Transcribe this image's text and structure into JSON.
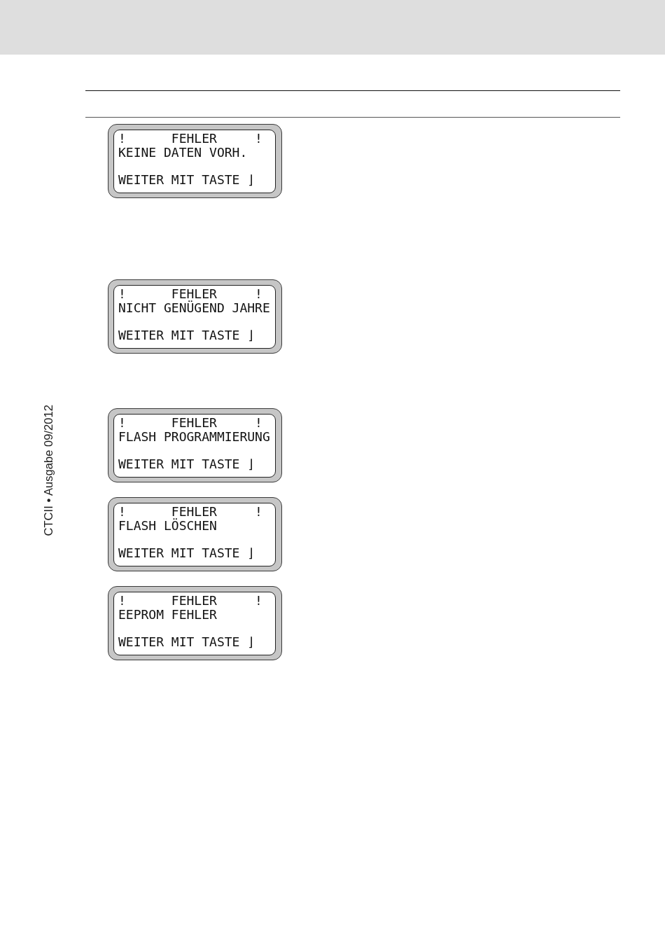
{
  "displays": [
    {
      "marks": [
        "!",
        "!"
      ],
      "title": "FEHLER",
      "message": "KEINE DATEN VORH.",
      "prompt": "WEITER MIT TASTE ⌋"
    },
    {
      "marks": [
        "!",
        "!"
      ],
      "title": "FEHLER",
      "message": "NICHT GENÜGEND JAHRE",
      "prompt": "WEITER MIT TASTE ⌋"
    },
    {
      "marks": [
        "!",
        "!"
      ],
      "title": "FEHLER",
      "message": "FLASH PROGRAMMIERUNG",
      "prompt": "WEITER MIT TASTE ⌋"
    },
    {
      "marks": [
        "!",
        "!"
      ],
      "title": "FEHLER",
      "message": "FLASH LÖSCHEN",
      "prompt": "WEITER MIT TASTE ⌋"
    },
    {
      "marks": [
        "!",
        "!"
      ],
      "title": "FEHLER",
      "message": "EEPROM FEHLER",
      "prompt": "WEITER MIT TASTE ⌋"
    }
  ],
  "footer": {
    "edition": "CTCII • Ausgabe 09/2012"
  }
}
